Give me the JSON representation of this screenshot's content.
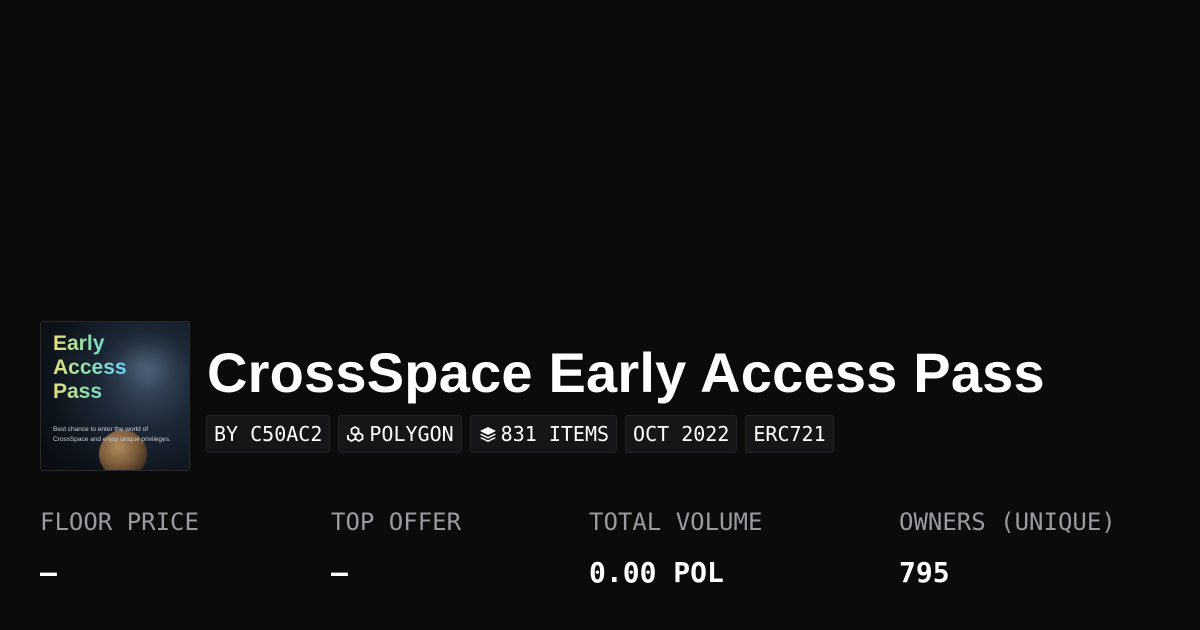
{
  "collection": {
    "name": "CrossSpace Early Access Pass",
    "thumbnail": {
      "title": "Early\nAccess\nPass",
      "subtitle": "Best chance to enter the world of CrossSpace and enjoy unique privileges."
    }
  },
  "tags": {
    "creator": "BY C50AC2",
    "chain": "POLYGON",
    "chain_icon": "polygon-icon",
    "items": "831 ITEMS",
    "items_icon": "layers-icon",
    "date": "OCT 2022",
    "standard": "ERC721"
  },
  "stats": [
    {
      "label": "FLOOR PRICE",
      "value": "–"
    },
    {
      "label": "TOP OFFER",
      "value": "–"
    },
    {
      "label": "TOTAL VOLUME",
      "value": "0.00 POL"
    },
    {
      "label": "OWNERS (UNIQUE)",
      "value": "795"
    }
  ],
  "colors": {
    "background": "#0b0b0c",
    "tag_background": "#161618",
    "label_text": "#9a9aa0",
    "value_text": "#ffffff"
  }
}
